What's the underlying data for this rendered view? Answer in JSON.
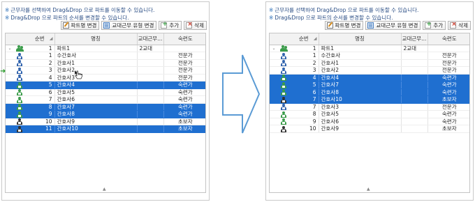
{
  "notices": [
    "근무자를 선택하여 Drag&Drop 으로 파트를 이동할 수 있습니다.",
    "Drag&Drop 으로 파트의 순서를 변경할 수 있습니다."
  ],
  "notice_mark": "※",
  "toolbar": {
    "part_change": "파트명 변경",
    "shift_type_change": "교대근무 유형 변경",
    "add": "추가",
    "delete": "삭제"
  },
  "columns": {
    "no": "순번",
    "name": "명칭",
    "shift": "교대근무...",
    "skill": "숙련도"
  },
  "colors": {
    "selection": "#1f6fd0",
    "notice_text": "#2c4f86",
    "arrow_stroke": "#5b9bd5"
  },
  "left": {
    "rows": [
      {
        "no": "1",
        "name": "파트1",
        "shift": "2교대",
        "skill": "",
        "icon": "group-icon",
        "expander": "⌄",
        "selected": false
      },
      {
        "no": "1",
        "name": "수간호사",
        "shift": "",
        "skill": "전문가",
        "icon": "nurse-icon",
        "selected": false
      },
      {
        "no": "2",
        "name": "간호사1",
        "shift": "",
        "skill": "전문가",
        "icon": "nurse-icon",
        "selected": false
      },
      {
        "no": "3",
        "name": "간호사2",
        "shift": "",
        "skill": "전문가",
        "icon": "nurse-icon",
        "selected": false
      },
      {
        "no": "4",
        "name": "간호사3",
        "shift": "",
        "skill": "전문가",
        "icon": "nurse-icon",
        "selected": false
      },
      {
        "no": "5",
        "name": "간호사4",
        "shift": "",
        "skill": "숙련가",
        "icon": "staff-icon",
        "selected": true
      },
      {
        "no": "6",
        "name": "간호사5",
        "shift": "",
        "skill": "숙련가",
        "icon": "staff-icon",
        "selected": false
      },
      {
        "no": "7",
        "name": "간호사6",
        "shift": "",
        "skill": "숙련가",
        "icon": "staff-icon",
        "selected": false
      },
      {
        "no": "8",
        "name": "간호사7",
        "shift": "",
        "skill": "숙련가",
        "icon": "staff-icon",
        "selected": true
      },
      {
        "no": "9",
        "name": "간호사8",
        "shift": "",
        "skill": "숙련가",
        "icon": "staff-icon",
        "selected": true
      },
      {
        "no": "10",
        "name": "간호사9",
        "shift": "",
        "skill": "초보자",
        "icon": "beginner-icon",
        "selected": false
      },
      {
        "no": "11",
        "name": "간호사10",
        "shift": "",
        "skill": "초보자",
        "icon": "beginner-icon",
        "selected": true
      }
    ]
  },
  "right": {
    "rows": [
      {
        "no": "1",
        "name": "파트1",
        "shift": "2교대",
        "skill": "",
        "icon": "group-icon",
        "expander": "⌄",
        "selected": false
      },
      {
        "no": "1",
        "name": "수간호사",
        "shift": "",
        "skill": "전문가",
        "icon": "nurse-icon",
        "selected": false
      },
      {
        "no": "2",
        "name": "간호사1",
        "shift": "",
        "skill": "전문가",
        "icon": "nurse-icon",
        "selected": false
      },
      {
        "no": "3",
        "name": "간호사2",
        "shift": "",
        "skill": "전문가",
        "icon": "nurse-icon",
        "selected": false
      },
      {
        "no": "4",
        "name": "간호사4",
        "shift": "",
        "skill": "숙련가",
        "icon": "staff-icon",
        "selected": true
      },
      {
        "no": "5",
        "name": "간호사7",
        "shift": "",
        "skill": "숙련가",
        "icon": "staff-icon",
        "selected": true
      },
      {
        "no": "6",
        "name": "간호사8",
        "shift": "",
        "skill": "숙련가",
        "icon": "staff-icon",
        "selected": true
      },
      {
        "no": "7",
        "name": "간호사10",
        "shift": "",
        "skill": "초보자",
        "icon": "beginner-icon",
        "selected": true
      },
      {
        "no": "7",
        "name": "간호사3",
        "shift": "",
        "skill": "전문가",
        "icon": "nurse-icon",
        "selected": false
      },
      {
        "no": "8",
        "name": "간호사5",
        "shift": "",
        "skill": "숙련가",
        "icon": "staff-icon",
        "selected": false
      },
      {
        "no": "9",
        "name": "간호사6",
        "shift": "",
        "skill": "숙련가",
        "icon": "staff-icon",
        "selected": false
      },
      {
        "no": "10",
        "name": "간호사9",
        "shift": "",
        "skill": "초보자",
        "icon": "beginner-icon",
        "selected": false
      }
    ]
  }
}
